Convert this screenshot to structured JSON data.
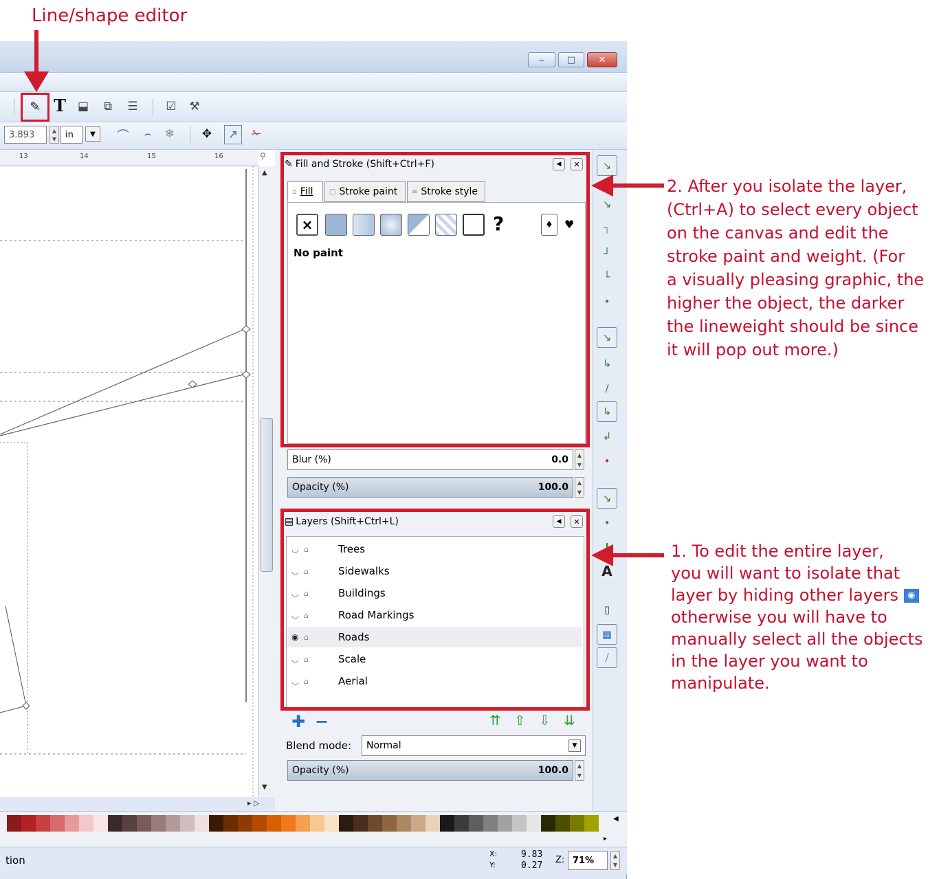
{
  "callouts": {
    "top_label": "Line/shape editor",
    "note2_lines": [
      "2. After you isolate the layer,",
      "(Ctrl+A) to select every object",
      "on the canvas and edit the",
      "stroke paint and weight. (For",
      "a visually pleasing graphic, the",
      "higher the object, the darker",
      "the lineweight should be since",
      "it will pop out more.)"
    ],
    "note1_lines": [
      "1. To edit the entire layer,",
      "you will want to isolate that",
      "layer by hiding other layers",
      "otherwise you will have to",
      "manually select all the objects",
      "in the layer you want to",
      "manipulate."
    ]
  },
  "window": {
    "controls": [
      "minimize-icon",
      "maximize-icon",
      "close-icon"
    ]
  },
  "toolbar": {
    "value": "3.893",
    "unit": "in",
    "text_tool": "T"
  },
  "ruler": {
    "ticks": [
      "13",
      "14",
      "15",
      "16"
    ]
  },
  "fill_stroke": {
    "title": "Fill and Stroke (Shift+Ctrl+F)",
    "tabs": [
      "Fill",
      "Stroke paint",
      "Stroke style"
    ],
    "paint_status": "No paint",
    "unset_symbol": "?",
    "none_symbol": "×",
    "blur_label": "Blur (%)",
    "blur_value": "0.0",
    "opacity_label": "Opacity (%)",
    "opacity_value": "100.0"
  },
  "layers": {
    "title": "Layers (Shift+Ctrl+L)",
    "items": [
      {
        "name": "Trees",
        "visible": false
      },
      {
        "name": "Sidewalks",
        "visible": false
      },
      {
        "name": "Buildings",
        "visible": false
      },
      {
        "name": "Road Markings",
        "visible": false
      },
      {
        "name": "Roads",
        "visible": true
      },
      {
        "name": "Scale",
        "visible": false
      },
      {
        "name": "Aerial",
        "visible": false
      }
    ],
    "blend_label": "Blend mode:",
    "blend_value": "Normal",
    "opacity_label": "Opacity (%)",
    "opacity_value": "100.0"
  },
  "statusbar": {
    "left_text": "tion",
    "x_label": "X:",
    "y_label": "Y:",
    "x_value": "9.83",
    "y_value": "0.27",
    "zoom_label": "Z:",
    "zoom_value": "71%"
  },
  "palette": [
    "#8b1a1a",
    "#b22222",
    "#c84040",
    "#d86a6a",
    "#e89a9a",
    "#f2c8c8",
    "#f8e4e4",
    "#3a2a2a",
    "#5a4040",
    "#7a5a5a",
    "#9a7a7a",
    "#b49a9a",
    "#d0bcbc",
    "#ece0e0",
    "#3c1a00",
    "#6a2e00",
    "#8e3a00",
    "#b44a00",
    "#d86000",
    "#f07a1a",
    "#f4a050",
    "#f8c890",
    "#fbe2c4",
    "#2a1a10",
    "#4a2e1a",
    "#6e4a2a",
    "#8e6640",
    "#ae8860",
    "#cca888",
    "#e8d2b8",
    "#1a1a1a",
    "#3c3c3c",
    "#5e5e5e",
    "#808080",
    "#a2a2a2",
    "#c4c4c4",
    "#e6e6e6",
    "#2a2a00",
    "#4e4e00",
    "#7a7a00",
    "#a2a200"
  ],
  "accent_color": "#c8102e"
}
